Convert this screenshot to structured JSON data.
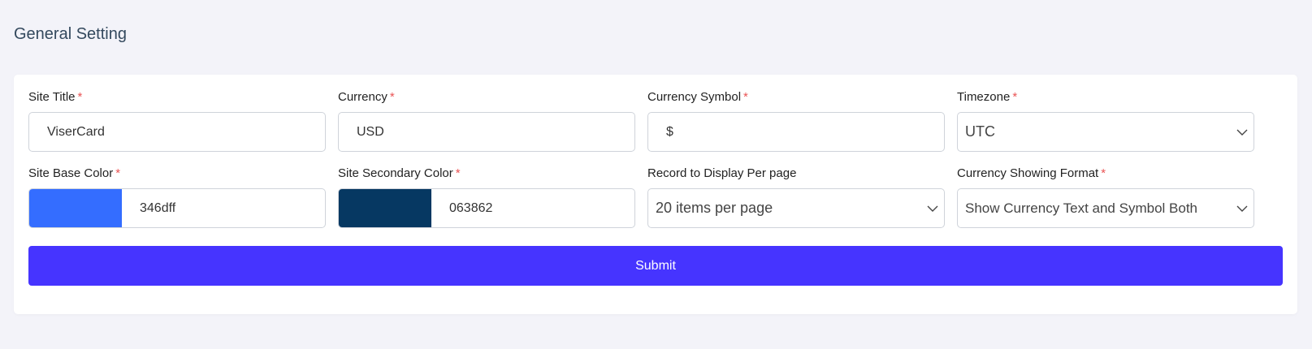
{
  "page": {
    "title": "General Setting"
  },
  "required_mark": "*",
  "fields": {
    "site_title": {
      "label": "Site Title",
      "value": "ViserCard",
      "required": true
    },
    "currency": {
      "label": "Currency",
      "value": "USD",
      "required": true
    },
    "currency_symbol": {
      "label": "Currency Symbol",
      "value": "$",
      "required": true
    },
    "timezone": {
      "label": "Timezone",
      "value": "UTC",
      "required": true,
      "icon": "chevron-down-icon"
    },
    "site_base_color": {
      "label": "Site Base Color",
      "value": "346dff",
      "swatch_color": "#346dff",
      "required": true
    },
    "site_secondary_color": {
      "label": "Site Secondary Color",
      "value": "063862",
      "swatch_color": "#063862",
      "required": true
    },
    "records_per_page": {
      "label": "Record to Display Per page",
      "value": "20 items per page",
      "required": false,
      "icon": "chevron-down-icon"
    },
    "currency_format": {
      "label": "Currency Showing Format",
      "value": "Show Currency Text and Symbol Both",
      "required": true,
      "icon": "chevron-down-icon"
    }
  },
  "submit": {
    "label": "Submit"
  },
  "colors": {
    "page_bg": "#f3f3f9",
    "card_bg": "#ffffff",
    "primary": "#4634ff",
    "required": "#ea5455",
    "border": "#cfd3da"
  }
}
